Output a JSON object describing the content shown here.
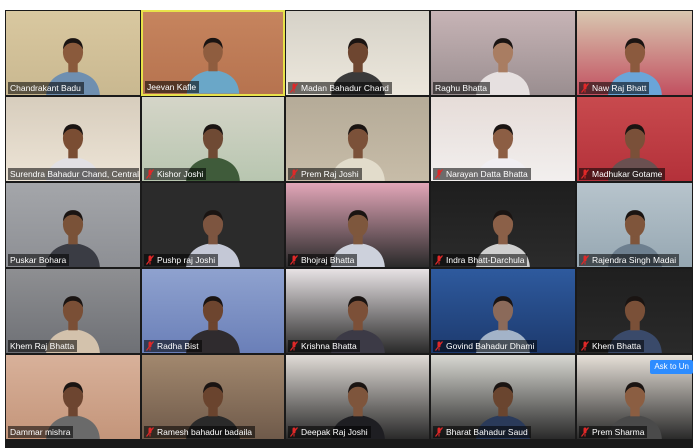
{
  "participants": [
    {
      "name": "Chandrakant Badu",
      "muted": false,
      "bg": "#c9b890",
      "wall": "#d9c8a0",
      "shirt": "#6f8fb0",
      "skin": "#8a5a3c"
    },
    {
      "name": "Jeevan Kafle",
      "muted": false,
      "active": true,
      "bg": "#b6734f",
      "wall": "#c6845e",
      "shirt": "#6aa7c8",
      "skin": "#8f5d3f"
    },
    {
      "name": "Madan Bahadur Chand",
      "muted": true,
      "bg": "#ece7dc",
      "wall": "#d6d2c8",
      "shirt": "#3a3a3a",
      "skin": "#6e4630"
    },
    {
      "name": "Raghu Bhatta",
      "muted": false,
      "bg": "#9a8e90",
      "wall": "#c7b4b6",
      "shirt": "#e6e0e0",
      "skin": "#a97d62"
    },
    {
      "name": "Naw Raj Bhatt",
      "muted": true,
      "bg": "#c25060",
      "wall": "#d8c7b0",
      "shirt": "#6aa5d8",
      "skin": "#8b5a3e"
    },
    {
      "name": "Surendra Bahadur Chand, Central Camp...",
      "muted": false,
      "bg": "#ede4d6",
      "wall": "#d7cdbd",
      "shirt": "#e2e0e4",
      "skin": "#7a4d33"
    },
    {
      "name": "Kishor Joshi",
      "muted": true,
      "bg": "#b8c6b0",
      "wall": "#d5d5c8",
      "shirt": "#3f5b3a",
      "skin": "#6f4a34"
    },
    {
      "name": "Prem Raj Joshi",
      "muted": true,
      "bg": "#c7bca8",
      "wall": "#b5ab98",
      "shirt": "#e2dccb",
      "skin": "#7b5139"
    },
    {
      "name": "Narayan Datta Bhatta",
      "muted": true,
      "bg": "#f2efee",
      "wall": "#e6dcd8",
      "shirt": "#f0eef2",
      "skin": "#8c5e44"
    },
    {
      "name": "Madhukar Gotame",
      "muted": true,
      "bg": "#b4313a",
      "wall": "#c84a4e",
      "shirt": "#6a5050",
      "skin": "#7a5039"
    },
    {
      "name": "Puskar Bohara",
      "muted": false,
      "bg": "#8d8f94",
      "wall": "#a4a6aa",
      "shirt": "#3a3c44",
      "skin": "#7a5238"
    },
    {
      "name": "Pushp raj Joshi",
      "muted": true,
      "bg": "#2b2b2b",
      "wall": "#2b2b2b",
      "shirt": "#c4c8d6",
      "skin": "#7d5540"
    },
    {
      "name": "Bhojraj Bhatta",
      "muted": true,
      "bg": "#2a2a2a",
      "wall": "#e2a6b8",
      "shirt": "#cdd1dc",
      "skin": "#7e573d"
    },
    {
      "name": "Indra Bhatt-Darchula",
      "muted": true,
      "bg": "#2b2b2b",
      "wall": "#1e1e1e",
      "shirt": "#cfcfcf",
      "skin": "#8b6048"
    },
    {
      "name": "Rajendra Singh Madai",
      "muted": true,
      "bg": "#96a7b2",
      "wall": "#b7c4cc",
      "shirt": "#6d7f8f",
      "skin": "#7f553b"
    },
    {
      "name": "Khem Raj Bhatta",
      "muted": false,
      "bg": "#6e7075",
      "wall": "#8e8f92",
      "shirt": "#d3c2ac",
      "skin": "#7a4f36"
    },
    {
      "name": "Radha Bist",
      "muted": true,
      "bg": "#6a7fb8",
      "wall": "#8fa2cf",
      "shirt": "#2f2b2e",
      "skin": "#6d452f"
    },
    {
      "name": "Krishna Bhatta",
      "muted": true,
      "bg": "#2a2a2a",
      "wall": "#e7e2e4",
      "shirt": "#3c3a46",
      "skin": "#7c5038"
    },
    {
      "name": "Govind Bahadur Dhami",
      "muted": true,
      "bg": "#1d3a6e",
      "wall": "#2e5a9e",
      "shirt": "#a3b3c8",
      "skin": "#8b6a5a"
    },
    {
      "name": "Khem Bhatta",
      "muted": true,
      "bg": "#2a2a2a",
      "wall": "#1f1f1f",
      "shirt": "#3a4a6a",
      "skin": "#7a5038"
    },
    {
      "name": "Dammar mishra",
      "muted": false,
      "bg": "#c4957a",
      "wall": "#d8b19a",
      "shirt": "#6a6a6a",
      "skin": "#6d4530"
    },
    {
      "name": "Ramesh bahadur badaila",
      "muted": true,
      "bg": "#6f5a4a",
      "wall": "#a2886e",
      "shirt": "#2a2a2a",
      "skin": "#6a442e"
    },
    {
      "name": "Deepak Raj Joshi",
      "muted": true,
      "bg": "#2a2a2a",
      "wall": "#e0dbd6",
      "shirt": "#1e1e22",
      "skin": "#7e553c"
    },
    {
      "name": "Bharat Bahadur Saud",
      "muted": true,
      "bg": "#2a2a2a",
      "wall": "#d8d8d2",
      "shirt": "#2a3a5a",
      "skin": "#6a452f"
    },
    {
      "name": "Prem Sharma",
      "muted": true,
      "bg": "#2a2a2a",
      "wall": "#e6e0d8",
      "shirt": "#4a4a4a",
      "skin": "#8b5e42"
    }
  ],
  "ask_button_label": "Ask to Un",
  "colors": {
    "active_border": "#e8e24a",
    "mic_muted": "#e02828",
    "ask_button": "#2d8cff"
  }
}
